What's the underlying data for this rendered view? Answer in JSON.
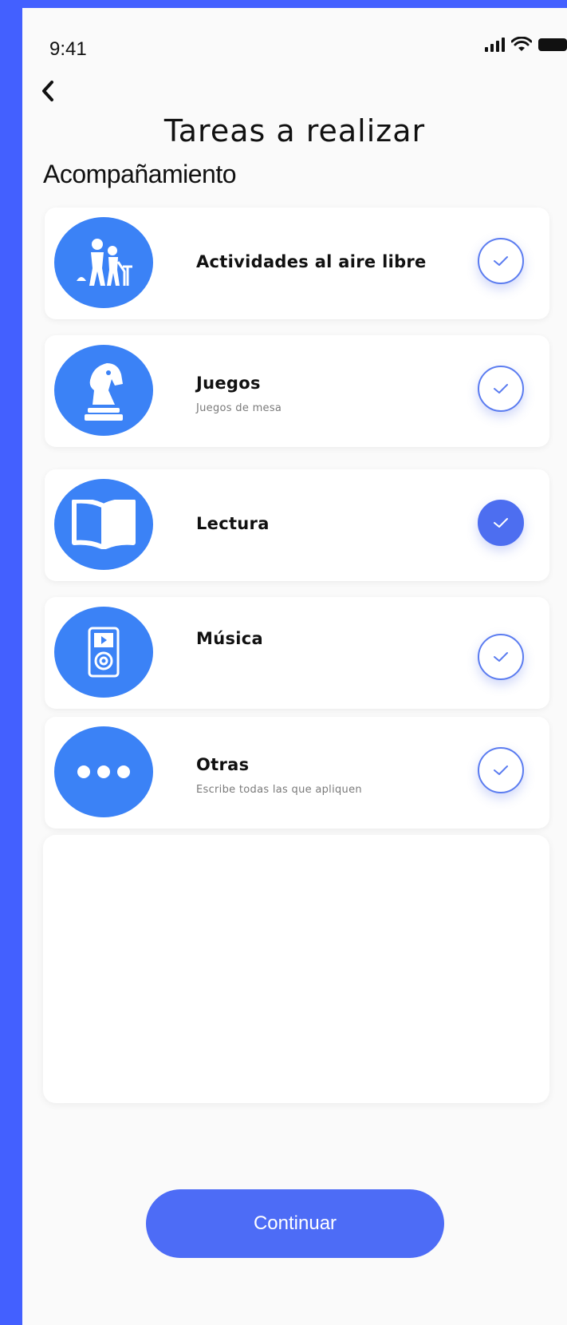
{
  "status_bar": {
    "time": "9:41"
  },
  "header": {
    "title": "Tareas a realizar",
    "subtitle": "Acompañamiento"
  },
  "tasks": [
    {
      "label": "Actividades al aire libre",
      "sublabel": "",
      "icon": "outdoor-activity-icon",
      "checked": false
    },
    {
      "label": "Juegos",
      "sublabel": "Juegos de mesa",
      "icon": "chess-knight-icon",
      "checked": false
    },
    {
      "label": "Lectura",
      "sublabel": "",
      "icon": "open-book-icon",
      "checked": true
    },
    {
      "label": "Música",
      "sublabel": "",
      "icon": "music-player-icon",
      "checked": false
    },
    {
      "label": "Otras",
      "sublabel": "Escribe todas las que apliquen",
      "icon": "more-dots-icon",
      "checked": false
    }
  ],
  "notes_input": {
    "value": "",
    "placeholder": ""
  },
  "footer": {
    "continue_label": "Continuar"
  },
  "colors": {
    "background": "#4360ff",
    "accent": "#4d6cf6",
    "icon_circle": "#3b82f6"
  }
}
